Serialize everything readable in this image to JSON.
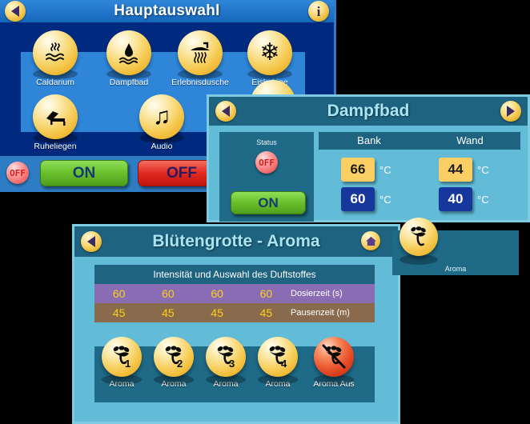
{
  "window_main": {
    "title": "Hauptauswahl",
    "back_icon": "back-arrow-icon",
    "info_icon": "info-icon",
    "icons": [
      {
        "label": "Caldarium",
        "glyph": "♒",
        "icon_name": "caldarium-heatwaves-icon"
      },
      {
        "label": "Dampfbad",
        "glyph": "♒",
        "icon_name": "dampfbad-droplet-icon"
      },
      {
        "label": "Erlebnisdusche",
        "glyph": "♒",
        "icon_name": "erlebnisdusche-shower-icon"
      },
      {
        "label": "Eiskabine",
        "glyph": "❄",
        "icon_name": "eiskabine-snowflake-icon"
      },
      {
        "label": "Ruheliegen",
        "glyph": "ὬF",
        "icon_name": "ruheliegen-bed-icon"
      },
      {
        "label": "Audio",
        "glyph": "♫",
        "icon_name": "audio-note-icon"
      }
    ],
    "status_led": "OFF",
    "on_label": "ON",
    "off_label": "OFF"
  },
  "window_steam": {
    "title": "Dampfbad",
    "back_icon": "back-arrow-icon",
    "forward_icon": "forward-arrow-icon",
    "status_label": "Status",
    "status_led": "OFF",
    "on_label": "ON",
    "columns": [
      "Bank",
      "Wand"
    ],
    "unit": "°C",
    "values": {
      "bank_set": "66",
      "bank_actual": "60",
      "wand_set": "44",
      "wand_actual": "40"
    }
  },
  "window_aroma": {
    "title": "Blütengrotte - Aroma",
    "back_icon": "back-arrow-icon",
    "home_icon": "home-icon",
    "table_header": "Intensität und Auswahl des Duftstoffes",
    "rows": [
      {
        "label": "Dosierzeit (s)",
        "values": [
          "60",
          "60",
          "60",
          "60"
        ]
      },
      {
        "label": "Pausenzeit (m)",
        "values": [
          "45",
          "45",
          "45",
          "45"
        ]
      }
    ],
    "buttons": [
      {
        "label": "Aroma",
        "number": "1",
        "icon_name": "aroma-flower-1-icon",
        "off": false
      },
      {
        "label": "Aroma",
        "number": "2",
        "icon_name": "aroma-flower-2-icon",
        "off": false
      },
      {
        "label": "Aroma",
        "number": "3",
        "icon_name": "aroma-flower-3-icon",
        "off": false
      },
      {
        "label": "Aroma",
        "number": "4",
        "icon_name": "aroma-flower-4-icon",
        "off": false
      },
      {
        "label": "Aroma Aus",
        "number": "",
        "icon_name": "aroma-off-icon",
        "off": true
      }
    ]
  },
  "panel_aroma": {
    "label": "Aroma",
    "icon_name": "aroma-flower-icon"
  },
  "colors": {
    "main_bg": "#002a80",
    "main_title_bar": "#2f86d8",
    "steam_bg": "#62bcd8",
    "steam_title_bar": "#1e6380",
    "orb_gold": "#f7cf5e",
    "orb_red": "#e8512a",
    "row_purple": "#8a6cb5",
    "row_brown": "#8a6a4d",
    "value_yellow": "#fcd116",
    "temp_yellow": "#fbcf63",
    "temp_blue": "#16379b",
    "btn_green": "#6cc22e",
    "btn_red": "#e22a22"
  }
}
